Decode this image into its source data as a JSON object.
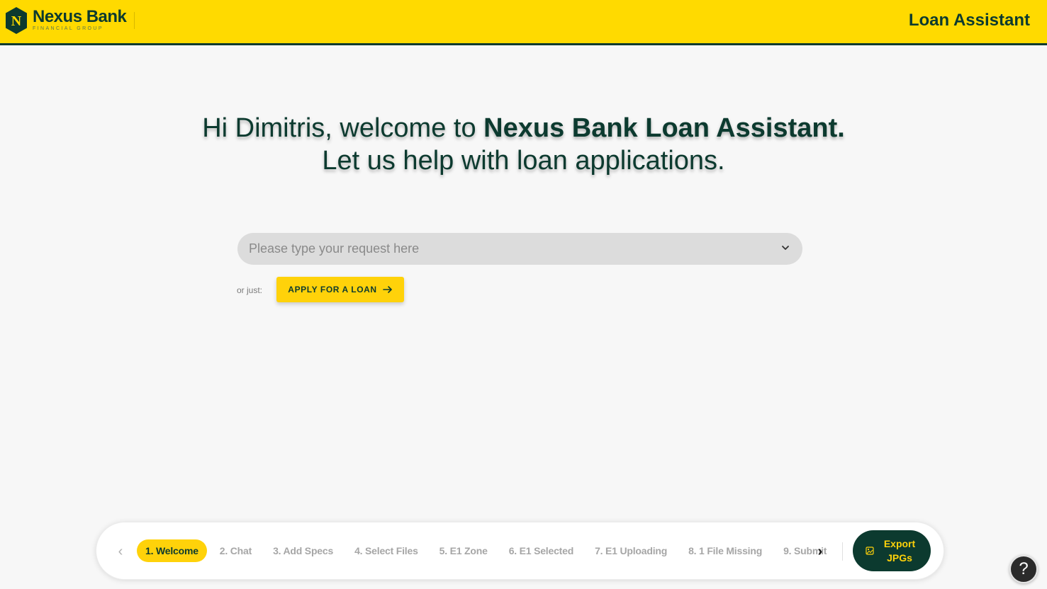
{
  "header": {
    "brand_name": "Nexus Bank",
    "brand_sub": "FINANCIAL GROUP",
    "logo_letter": "N",
    "title": "Loan Assistant",
    "colors": {
      "bar": "#ffda00",
      "accent": "#0c3a2f"
    }
  },
  "hero": {
    "greeting": "Hi Dimitris, welcome to ",
    "app_name": "Nexus Bank Loan Assistant.",
    "subline": "Let us help with loan applications."
  },
  "search": {
    "placeholder": "Please type your request here",
    "value": "",
    "icon": "chevron-down-icon"
  },
  "quick_action": {
    "prefix": "or just:",
    "apply_label": "APPLY FOR A LOAN",
    "icon": "arrow-right-icon"
  },
  "stepper": {
    "steps": [
      {
        "label": "1. Welcome",
        "active": true
      },
      {
        "label": "2. Chat",
        "active": false
      },
      {
        "label": "3. Add Specs",
        "active": false
      },
      {
        "label": "4. Select Files",
        "active": false
      },
      {
        "label": "5. E1 Zone",
        "active": false
      },
      {
        "label": "6. E1 Selected",
        "active": false
      },
      {
        "label": "7. E1 Uploading",
        "active": false
      },
      {
        "label": "8. 1 File Missing",
        "active": false
      },
      {
        "label": "9. Submit",
        "active": false
      }
    ],
    "prev_glyph": "‹",
    "next_glyph": "›",
    "export_label_1": "Export",
    "export_label_2": "JPGs",
    "export_icon": "image-export-icon"
  },
  "help": {
    "glyph": "?"
  }
}
